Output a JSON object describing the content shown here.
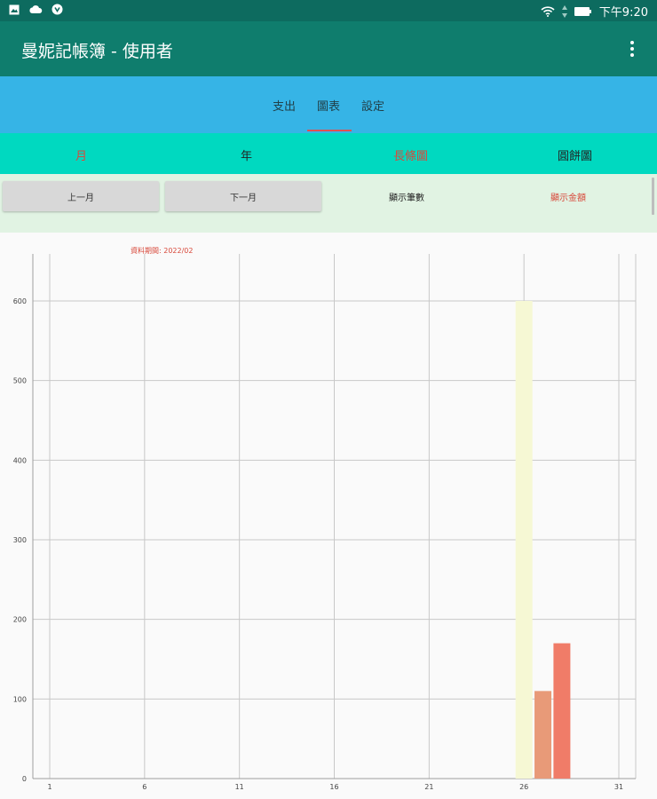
{
  "status_bar": {
    "left_icons": [
      "image-icon",
      "cloud-icon",
      "app-notification-icon"
    ],
    "right_icons": [
      "wifi-icon",
      "signal-icon",
      "battery-icon"
    ],
    "time": "下午9:20"
  },
  "app_bar": {
    "title": "曼妮記帳簿 - 使用者",
    "overflow_icon": "more-vert-icon"
  },
  "tabs": [
    {
      "label": "支出",
      "selected": false
    },
    {
      "label": "圖表",
      "selected": true
    },
    {
      "label": "設定",
      "selected": false
    }
  ],
  "sub_options": [
    {
      "label": "月",
      "highlight": true
    },
    {
      "label": "年",
      "highlight": false
    },
    {
      "label": "長條圖",
      "highlight": true
    },
    {
      "label": "圓餅圖",
      "highlight": false
    }
  ],
  "buttons": {
    "prev_month": "上一月",
    "next_month": "下一月"
  },
  "toggles": {
    "show_count": "顯示筆數",
    "show_amount": "顯示金額"
  },
  "chart": {
    "period_label": "資料期間: 2022/02"
  },
  "colors": {
    "status_bar": "#0d6b5f",
    "app_bar": "#0f7d6d",
    "tab_bar": "#36b4e6",
    "tab_indicator": "#e05050",
    "sub_bar": "#00d9c0",
    "button_row": "#e1f3e3",
    "highlight_text": "#d84a3c"
  },
  "chart_data": {
    "type": "bar",
    "x_ticks": [
      1,
      6,
      11,
      16,
      21,
      26,
      31
    ],
    "y_ticks": [
      0,
      100,
      200,
      300,
      400,
      500,
      600
    ],
    "xlim": [
      0,
      31
    ],
    "ylim": [
      0,
      600
    ],
    "grid": true,
    "bars": [
      {
        "day": 26,
        "value": 600,
        "color": "#f6f8d4"
      },
      {
        "day": 27,
        "value": 110,
        "color": "#e89a78"
      },
      {
        "day": 28,
        "value": 170,
        "color": "#f07c68"
      }
    ]
  }
}
